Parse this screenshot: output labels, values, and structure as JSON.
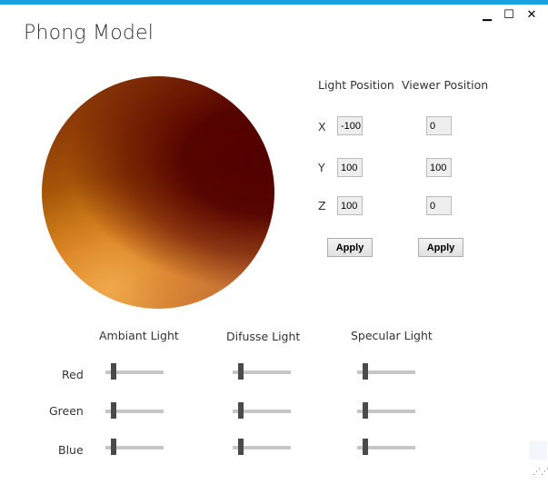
{
  "window": {
    "title": "Phong Model",
    "minimize_glyph": "▁",
    "maximize_glyph": "☐",
    "close_glyph": "✕",
    "accent": "#1ba1e2"
  },
  "sphere": {
    "dark_color": "#4f0000",
    "light_color": "#d68a2c"
  },
  "positions": {
    "light_header": "Light Position",
    "viewer_header": "Viewer Position",
    "axes": [
      "X",
      "Y",
      "Z"
    ],
    "light": {
      "x": "-100",
      "y": "100",
      "z": "100"
    },
    "viewer": {
      "x": "0",
      "y": "100",
      "z": "0"
    },
    "apply_label": "Apply"
  },
  "lighting": {
    "headers": [
      "Ambiant Light",
      "Difusse Light",
      "Specular Light"
    ],
    "channels": [
      "Red",
      "Green",
      "Blue"
    ],
    "values": {
      "ambient": [
        0.1,
        0.1,
        0.1
      ],
      "diffuse": [
        0.1,
        0.1,
        0.1
      ],
      "specular": [
        0.1,
        0.1,
        0.1
      ]
    }
  }
}
